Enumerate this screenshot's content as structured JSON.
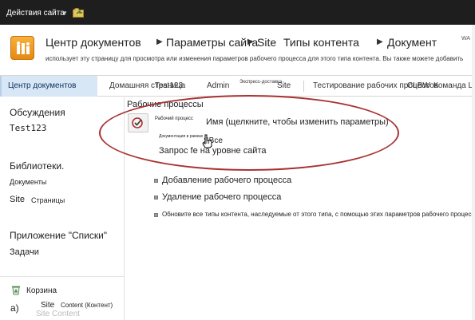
{
  "ribbon": {
    "site_actions": "Действия сайта"
  },
  "header": {
    "breadcrumbs": [
      "Центр документов",
      "Параметры сайта",
      "Site",
      "Типы контента",
      "Документ"
    ],
    "description": "использует эту страницу для просмотра или изменения параметров рабочего процесса для этого типа контента. Вы также можете добавить",
    "right_text": "WA"
  },
  "topnav": {
    "tabs": [
      "Центр документов",
      "Домашняя страница",
      "Test123",
      "Admin",
      "Экспресс-доставка",
      "Site",
      "Тестирование рабочих процессов",
      "CLBW",
      "Команда LIA"
    ]
  },
  "leftnav": {
    "discussions": "Обсуждения",
    "test123": "Test123",
    "libraries": "Библиотеки.",
    "documents": "Документы",
    "site": "Site",
    "pages": "Страницы",
    "lists_app": "Приложение \"Списки\"",
    "tasks": "Задачи",
    "recycle_bin": "Корзина",
    "footnote_a": "а)",
    "site_content_site": "Site",
    "site_content_label": "Content (Контент)",
    "site_content_ghost": "Site Content"
  },
  "main": {
    "section_title": "Рабочие процессы",
    "workflow_label": "Рабочий процесс",
    "name_hint": "Имя (щелкните, чтобы изменить параметры)",
    "doc_approval": "Документация в рамках",
    "sbce": "SBce",
    "site_request": "Запрос fe на уровне сайта",
    "add_workflow": "Добавление рабочего процесса",
    "remove_workflow": "Удаление рабочего процесса",
    "update_all": "Обновите все типы контента, наследуемые от этого типа, с помощью этих параметров рабочего процесса"
  },
  "colors": {
    "highlight_oval": "#a83232",
    "selected_tab_bg": "#d7e7f6",
    "ribbon_bg": "#1e1e1e",
    "logo_orange": "#f0a030"
  },
  "icons": {
    "logo": "document-center-logo-icon",
    "workflow": "workflow-icon",
    "recycle": "recycle-bin-icon",
    "browse": "browse-folder-icon",
    "cursor": "hand-pointer-icon"
  }
}
